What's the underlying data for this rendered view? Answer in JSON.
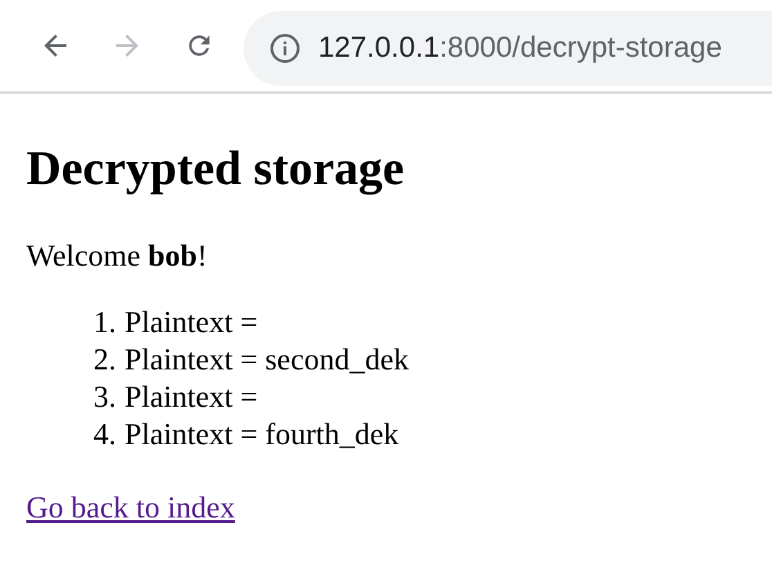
{
  "toolbar": {
    "back": {
      "disabled": false
    },
    "forward": {
      "disabled": true
    },
    "address": {
      "host": "127.0.0.1",
      "rest": ":8000/decrypt-storage"
    }
  },
  "page": {
    "heading": "Decrypted storage",
    "welcome": "Welcome **bob**!",
    "items": [
      {
        "number": "1.",
        "text": "Plaintext ="
      },
      {
        "number": "2.",
        "text": "Plaintext = second_dek"
      },
      {
        "number": "3.",
        "text": "Plaintext ="
      },
      {
        "number": "4.",
        "text": "Plaintext = fourth_dek"
      }
    ],
    "link": "Go back to index"
  }
}
